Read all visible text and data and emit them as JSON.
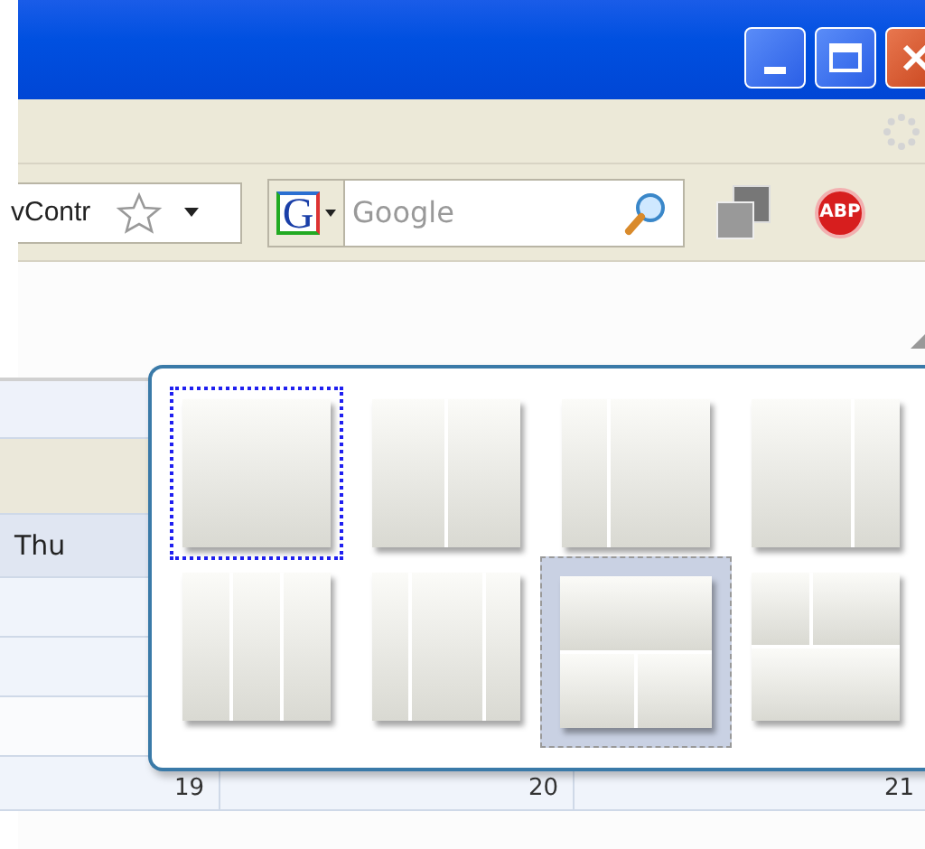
{
  "address_bar": {
    "text": "vContr"
  },
  "search": {
    "engine_letter": "G",
    "placeholder": "Google"
  },
  "adblock": {
    "label": "ABP"
  },
  "calendar": {
    "day_header": "Thu",
    "dates": [
      "19",
      "20",
      "21"
    ]
  },
  "layout_picker": {
    "tiles": [
      {
        "kind": "single",
        "focused": true,
        "selected": false
      },
      {
        "kind": "two-equal",
        "focused": false,
        "selected": false
      },
      {
        "kind": "narrow-left",
        "focused": false,
        "selected": false
      },
      {
        "kind": "narrow-right",
        "focused": false,
        "selected": false
      },
      {
        "kind": "three-equal",
        "focused": false,
        "selected": false
      },
      {
        "kind": "wide-center",
        "focused": false,
        "selected": false
      },
      {
        "kind": "top-over-two",
        "focused": false,
        "selected": true
      },
      {
        "kind": "two-over-bottom",
        "focused": false,
        "selected": false
      }
    ]
  }
}
